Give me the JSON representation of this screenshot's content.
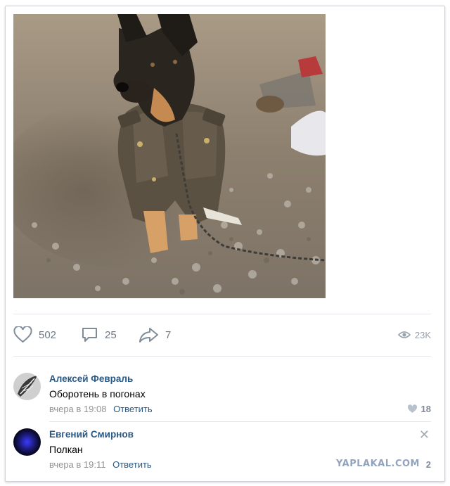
{
  "post": {
    "photo_icon": "dog-photo",
    "likes": "502",
    "comments": "25",
    "shares": "7",
    "views": "23K"
  },
  "comments": [
    {
      "author": "Алексей Февраль",
      "text": "Оборотень в погонах",
      "time": "вчера в 19:08",
      "reply_label": "Ответить",
      "likes": "18",
      "avatar_icon": "feather-avatar"
    },
    {
      "author": "Евгений Смирнов",
      "text": "Полкан",
      "time": "вчера в 19:11",
      "reply_label": "Ответить",
      "likes": "2",
      "avatar_icon": "blue-glow-avatar"
    }
  ],
  "watermark": "YAPLAKAL.COM",
  "colors": {
    "link": "#2a5885",
    "muted": "#6d7885",
    "divider": "#e3e6ea"
  }
}
